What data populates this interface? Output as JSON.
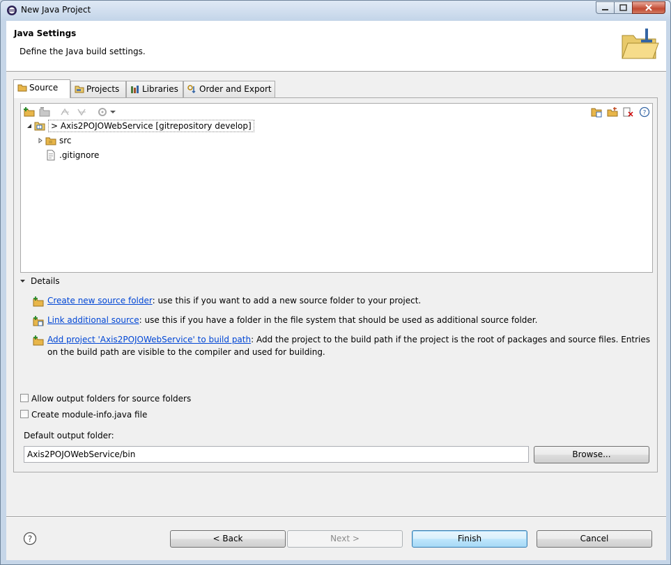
{
  "window": {
    "title": "New Java Project"
  },
  "header": {
    "title": "Java Settings",
    "description": "Define the Java build settings."
  },
  "tabs": [
    {
      "label": "Source",
      "icon": "source-folder-icon"
    },
    {
      "label": "Projects",
      "icon": "projects-icon"
    },
    {
      "label": "Libraries",
      "icon": "libraries-icon"
    },
    {
      "label": "Order and Export",
      "icon": "order-export-icon"
    }
  ],
  "tree": {
    "project": "> Axis2POJOWebService [gitrepository develop]",
    "children": [
      {
        "label": "src",
        "icon": "package-folder-icon"
      },
      {
        "label": ".gitignore",
        "icon": "file-icon"
      }
    ]
  },
  "details": {
    "toggle_label": "Details",
    "items": [
      {
        "link": "Create new source folder",
        "text": ": use this if you want to add a new source folder to your project."
      },
      {
        "link": "Link additional source",
        "text": ": use this if you have a folder in the file system that should be used as additional source folder."
      },
      {
        "link": "Add project 'Axis2POJOWebService' to build path",
        "text": ": Add the project to the build path if the project is the root of packages and source files. Entries on the build path are visible to the compiler and used for building."
      }
    ]
  },
  "options": {
    "allow_output": "Allow output folders for source folders",
    "create_module": "Create module-info.java file"
  },
  "output": {
    "label": "Default output folder:",
    "value": "Axis2POJOWebService/bin",
    "browse": "Browse..."
  },
  "buttons": {
    "back": "< Back",
    "next": "Next >",
    "finish": "Finish",
    "cancel": "Cancel"
  },
  "colors": {
    "link": "#0046d5",
    "accent": "#3c7fb1"
  }
}
